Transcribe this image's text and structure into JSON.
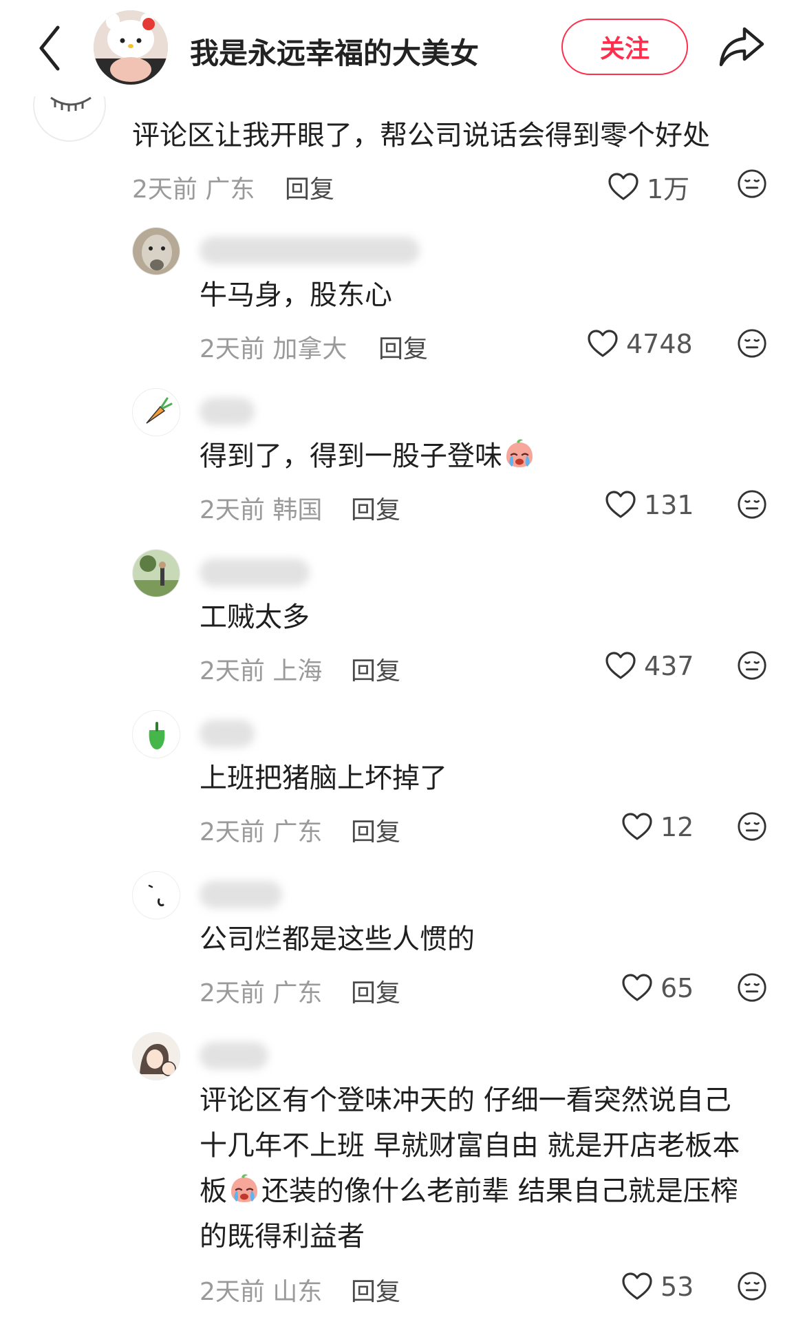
{
  "header": {
    "author_name": "我是永远幸福的大美女",
    "follow_label": "关注"
  },
  "top_comment": {
    "text": "评论区让我开眼了，帮公司说话会得到零个好处",
    "time": "2天前",
    "location": "广东",
    "reply_label": "回复",
    "likes": "1万"
  },
  "replies": [
    {
      "text": "牛马身，股东心",
      "time": "2天前",
      "location": "加拿大",
      "reply_label": "回复",
      "likes": "4748"
    },
    {
      "text": "得到了，得到一股子登味",
      "time": "2天前",
      "location": "韩国",
      "reply_label": "回复",
      "likes": "131"
    },
    {
      "text": "工贼太多",
      "time": "2天前",
      "location": "上海",
      "reply_label": "回复",
      "likes": "437"
    },
    {
      "text": "上班把猪脑上坏掉了",
      "time": "2天前",
      "location": "广东",
      "reply_label": "回复",
      "likes": "12"
    },
    {
      "text": "公司烂都是这些人惯的",
      "time": "2天前",
      "location": "广东",
      "reply_label": "回复",
      "likes": "65"
    },
    {
      "text_lines": [
        "评论区有个登味冲天的 仔细一看突然说自己",
        "十几年不上班 早就财富自由 就是开店老板本",
        "板",
        "还装的像什么老前辈 结果自己就是压榨",
        "的既得利益者"
      ],
      "time": "2天前",
      "location": "山东",
      "reply_label": "回复",
      "likes": "53"
    }
  ],
  "colors": {
    "accent": "#ff2e4d",
    "meta_gray": "#9a9a9a",
    "text": "#1f1f1f"
  },
  "icons": [
    "back-arrow-icon",
    "share-icon",
    "heart-icon",
    "emoji-face-icon",
    "crying-emoji-icon"
  ]
}
